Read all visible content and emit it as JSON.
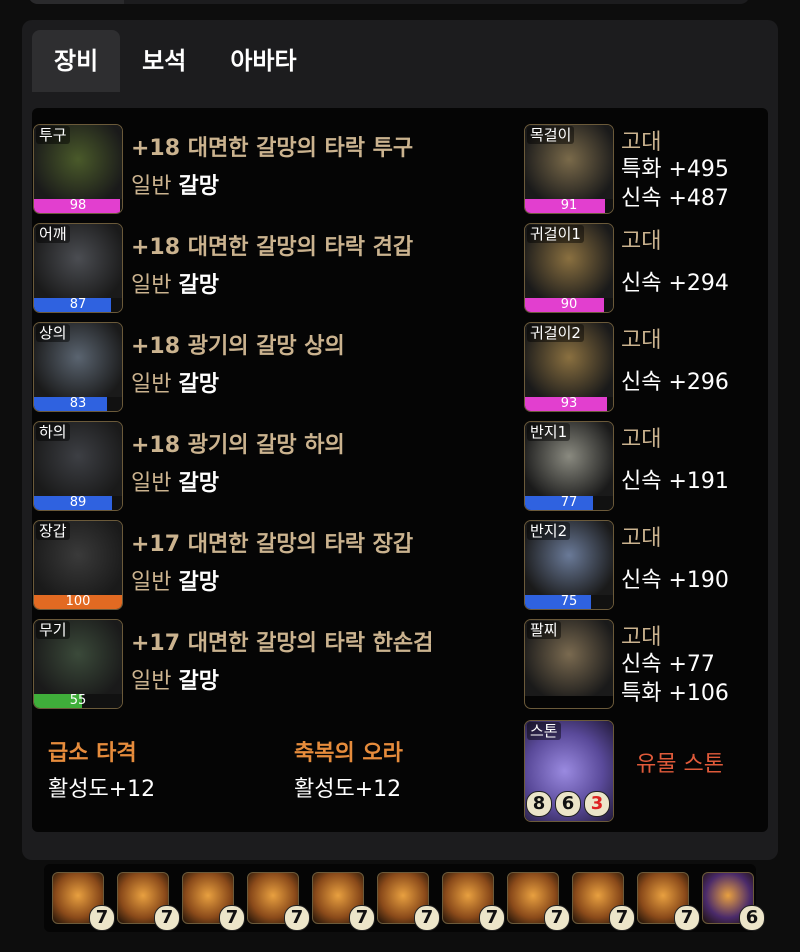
{
  "tabs": [
    {
      "label": "장비",
      "active": true
    },
    {
      "label": "보석",
      "active": false
    },
    {
      "label": "아바타",
      "active": false
    }
  ],
  "equipment": [
    {
      "slot": "투구",
      "quality": 98,
      "quality_color": "#e23fcf",
      "name": "+18 대면한 갈망의 타락 투구",
      "grade": "일반",
      "set": "갈망",
      "icon": "helmet-icon",
      "art": "#4a5a2a"
    },
    {
      "slot": "어깨",
      "quality": 87,
      "quality_color": "#2f62e0",
      "name": "+18 대면한 갈망의 타락 견갑",
      "grade": "일반",
      "set": "갈망",
      "icon": "shoulder-icon",
      "art": "#4b4d52"
    },
    {
      "slot": "상의",
      "quality": 83,
      "quality_color": "#2f62e0",
      "name": "+18 광기의 갈망 상의",
      "grade": "일반",
      "set": "갈망",
      "icon": "chest-armor-icon",
      "art": "#5a6470"
    },
    {
      "slot": "하의",
      "quality": 89,
      "quality_color": "#2f62e0",
      "name": "+18 광기의 갈망 하의",
      "grade": "일반",
      "set": "갈망",
      "icon": "pants-icon",
      "art": "#3d3f44"
    },
    {
      "slot": "장갑",
      "quality": 100,
      "quality_color": "#e26a22",
      "name": "+17 대면한 갈망의 타락 장갑",
      "grade": "일반",
      "set": "갈망",
      "icon": "gloves-icon",
      "art": "#3a3a3a"
    },
    {
      "slot": "무기",
      "quality": 55,
      "quality_color": "#3fae3a",
      "name": "+17 대면한 갈망의 타락 한손검",
      "grade": "일반",
      "set": "갈망",
      "icon": "sword-icon",
      "art": "#3b4a3a"
    }
  ],
  "accessories": [
    {
      "slot": "목걸이",
      "quality": 91,
      "quality_color": "#e23fcf",
      "grade": "고대",
      "stats": [
        "특화 +495",
        "신속 +487"
      ],
      "icon": "necklace-icon",
      "art": "#7a6a4a"
    },
    {
      "slot": "귀걸이1",
      "quality": 90,
      "quality_color": "#e23fcf",
      "grade": "고대",
      "stats": [
        "신속 +294"
      ],
      "icon": "earring-icon",
      "art": "#8a7040"
    },
    {
      "slot": "귀걸이2",
      "quality": 93,
      "quality_color": "#e23fcf",
      "grade": "고대",
      "stats": [
        "신속 +296"
      ],
      "icon": "earring-icon",
      "art": "#8a7040"
    },
    {
      "slot": "반지1",
      "quality": 77,
      "quality_color": "#2f62e0",
      "grade": "고대",
      "stats": [
        "신속 +191"
      ],
      "icon": "ring-icon",
      "art": "#8a8a80"
    },
    {
      "slot": "반지2",
      "quality": 75,
      "quality_color": "#2f62e0",
      "grade": "고대",
      "stats": [
        "신속 +190"
      ],
      "icon": "ring-icon",
      "art": "#6a7a98"
    },
    {
      "slot": "팔찌",
      "grade": "고대",
      "stats": [
        "신속 +77",
        "특화 +106"
      ],
      "icon": "bracelet-icon",
      "art": "#7a6a50"
    }
  ],
  "engravings": [
    {
      "name": "급소 타격",
      "value": "활성도+12"
    },
    {
      "name": "축복의 오라",
      "value": "활성도+12"
    }
  ],
  "stone": {
    "slot": "스톤",
    "label": "유물 스톤",
    "levels": [
      "8",
      "6",
      "3"
    ],
    "icon": "ability-stone-icon",
    "art": "#5a4a9a"
  },
  "gems": [
    {
      "level": "7",
      "color": "#8a4a1a"
    },
    {
      "level": "7",
      "color": "#8a4a1a"
    },
    {
      "level": "7",
      "color": "#8a4a1a"
    },
    {
      "level": "7",
      "color": "#8a4a1a"
    },
    {
      "level": "7",
      "color": "#8a4a1a"
    },
    {
      "level": "7",
      "color": "#8a4a1a"
    },
    {
      "level": "7",
      "color": "#8a4a1a"
    },
    {
      "level": "7",
      "color": "#8a4a1a"
    },
    {
      "level": "7",
      "color": "#8a4a1a"
    },
    {
      "level": "7",
      "color": "#8a4a1a"
    },
    {
      "level": "6",
      "color": "#4a2a6a"
    }
  ]
}
